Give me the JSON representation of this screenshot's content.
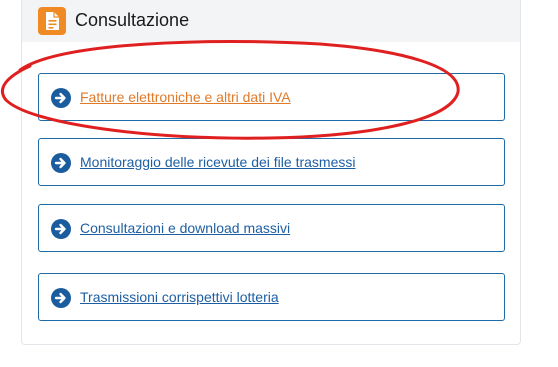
{
  "section": {
    "title": "Consultazione",
    "icon": "document-icon",
    "icon_color": "#f08a24"
  },
  "links": [
    {
      "label": "Fatture elettroniche e altri dati IVA",
      "color": "#e07a28",
      "icon": "arrow-right-circle-icon"
    },
    {
      "label": "Monitoraggio delle ricevute dei file trasmessi",
      "color": "#1e5fa3",
      "icon": "arrow-right-circle-icon"
    },
    {
      "label": "Consultazioni e download massivi",
      "color": "#1e5fa3",
      "icon": "arrow-right-circle-icon"
    },
    {
      "label": "Trasmissioni corrispettivi lotteria",
      "color": "#1e5fa3",
      "icon": "arrow-right-circle-icon"
    }
  ],
  "colors": {
    "link_border": "#1e6ba8",
    "arrow": "#1b5c9e",
    "annotation": "#e02020"
  }
}
